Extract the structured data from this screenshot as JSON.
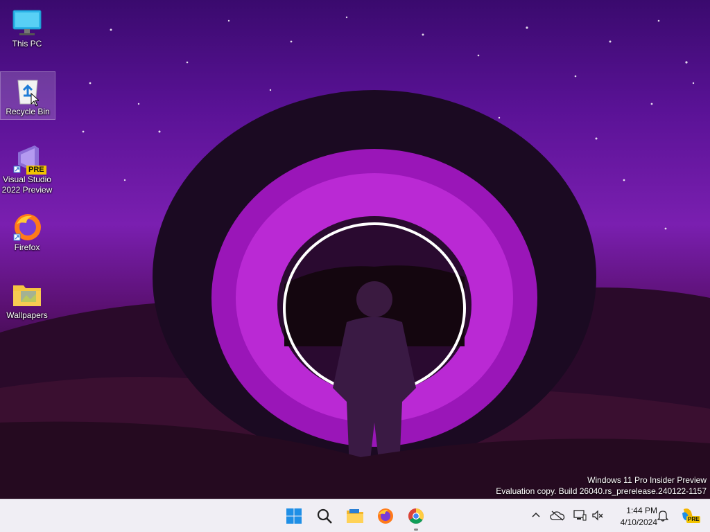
{
  "desktop": {
    "icons": [
      {
        "label": "This PC",
        "icon": "monitor-icon"
      },
      {
        "label": "Recycle Bin",
        "icon": "recycle-bin-icon",
        "selected": true
      },
      {
        "label": "Visual Studio 2022 Preview",
        "line1": "Visual Studio",
        "line2": "2022 Preview",
        "icon": "visual-studio-icon",
        "badge": "PRE"
      },
      {
        "label": "Firefox",
        "icon": "firefox-icon"
      },
      {
        "label": "Wallpapers",
        "icon": "folder-icon"
      }
    ],
    "watermark": {
      "line1": "Windows 11 Pro Insider Preview",
      "line2": "Evaluation copy. Build 26040.rs_prerelease.240122-1157"
    }
  },
  "taskbar": {
    "apps": [
      {
        "name": "Start",
        "icon": "windows-start-icon"
      },
      {
        "name": "Search",
        "icon": "search-icon"
      },
      {
        "name": "File Explorer",
        "icon": "file-explorer-icon"
      },
      {
        "name": "Firefox",
        "icon": "firefox-icon"
      },
      {
        "name": "Chrome",
        "icon": "chrome-icon"
      }
    ],
    "tray": [
      "chevron-up-icon",
      "onedrive-icon",
      "network-icon",
      "volume-muted-icon"
    ],
    "clock": {
      "time": "1:44 PM",
      "date": "4/10/2024"
    },
    "notification_icon": "bell-icon",
    "copilot_badge": "PRE"
  }
}
